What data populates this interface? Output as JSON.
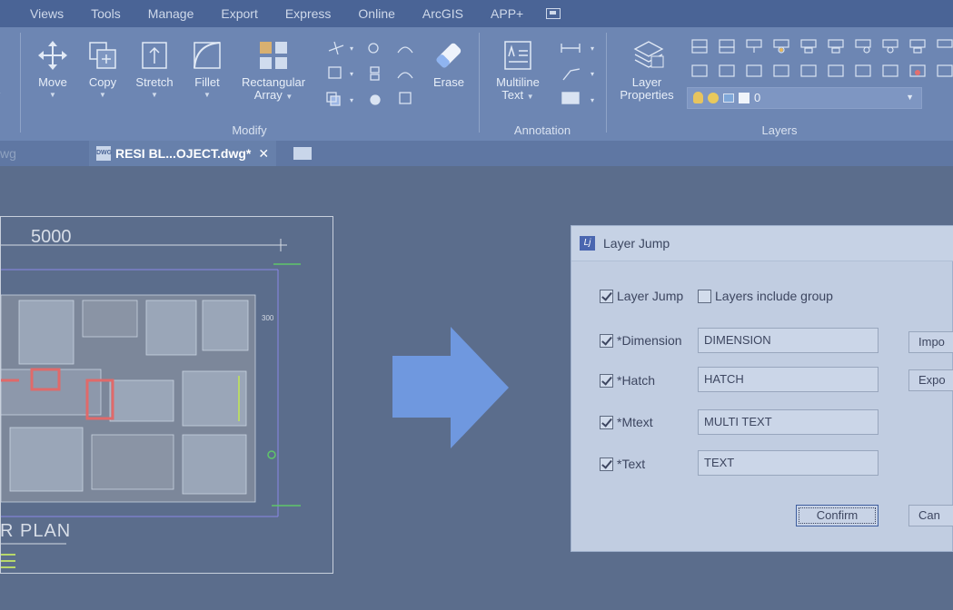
{
  "menu": [
    "Views",
    "Tools",
    "Manage",
    "Export",
    "Express",
    "Online",
    "ArcGIS",
    "APP+"
  ],
  "ribbon": {
    "modify": {
      "buttons": [
        {
          "label": "Move",
          "icon": "move-icon"
        },
        {
          "label": "Copy",
          "icon": "copy-icon"
        },
        {
          "label": "Stretch",
          "icon": "stretch-icon"
        },
        {
          "label": "Fillet",
          "icon": "fillet-icon"
        },
        {
          "label": "Rectangular",
          "label2": "Array",
          "icon": "rectangular-array-icon"
        },
        {
          "label": "Erase",
          "icon": "erase-icon"
        }
      ],
      "panel_label": "Modify"
    },
    "annotation": {
      "button": {
        "label": "Multiline",
        "label2": "Text",
        "icon": "multiline-text-icon"
      },
      "panel_label": "Annotation"
    },
    "layers": {
      "button": {
        "label": "Layer",
        "label2": "Properties",
        "icon": "layer-properties-icon"
      },
      "current_layer": "0",
      "panel_label": "Layers"
    }
  },
  "tabs": {
    "left_partial": "wg",
    "active": "RESI BL...OJECT.dwg*",
    "close": "✕",
    "dwg_icon_label": "DWG"
  },
  "drawing": {
    "dimension": "5000",
    "plan_label": "R  PLAN",
    "small_dim": "300"
  },
  "dialog": {
    "title": "Layer Jump",
    "icon_glyph": "Lj",
    "layer_jump": {
      "label": "Layer Jump",
      "checked": true
    },
    "include_group": {
      "label": "Layers include group",
      "checked": false
    },
    "rows": [
      {
        "label": "*Dimension",
        "value": "DIMENSION",
        "checked": true
      },
      {
        "label": "*Hatch",
        "value": "HATCH",
        "checked": true
      },
      {
        "label": "*Mtext",
        "value": "MULTI TEXT",
        "checked": true
      },
      {
        "label": "*Text",
        "value": "TEXT",
        "checked": true
      }
    ],
    "import_label": "Impo",
    "export_label": "Expo",
    "confirm_label": "Confirm",
    "cancel_label": "Can"
  },
  "colors": {
    "ribbon": "#6d86b3",
    "menubar": "#4a6496",
    "dialog": "#c1cde1",
    "arrow": "#6f98df",
    "canvas": "#5b6d8c"
  }
}
